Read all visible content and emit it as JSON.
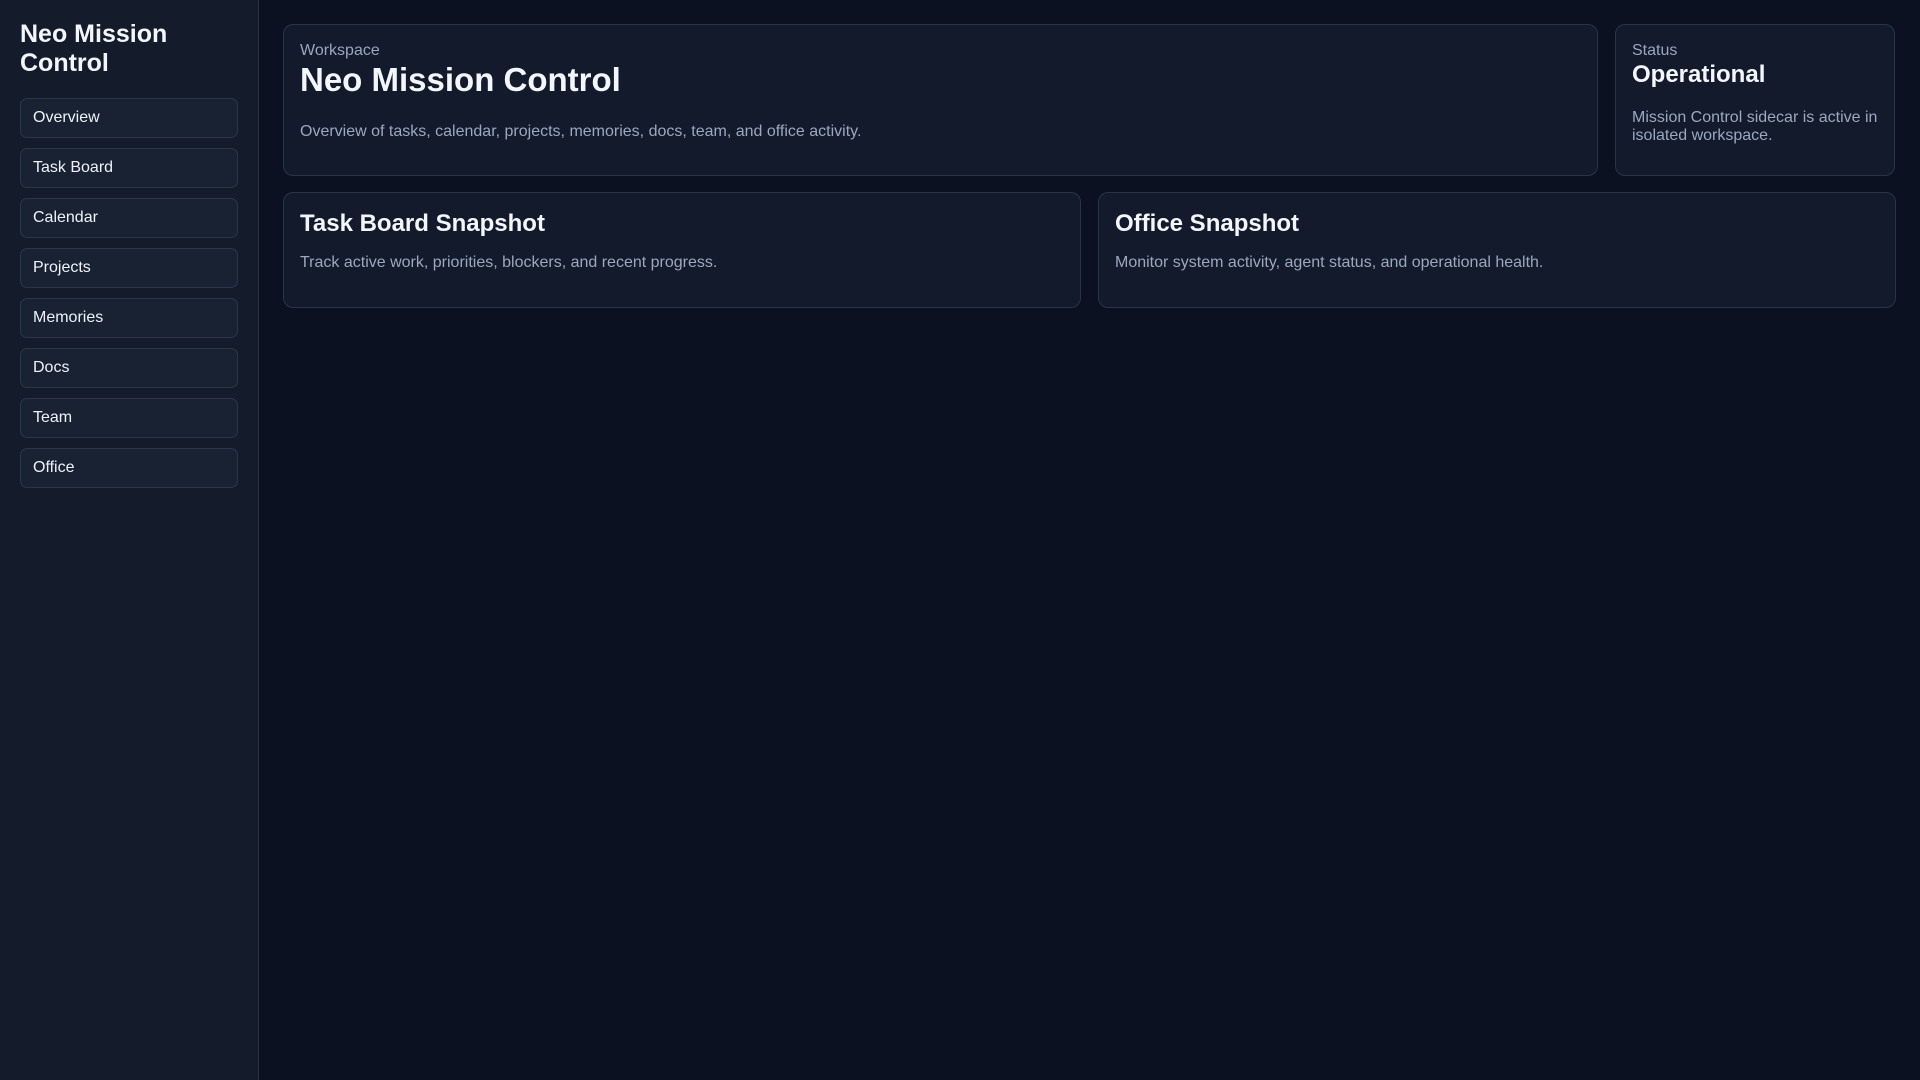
{
  "sidebar": {
    "brand": "Neo Mission Control",
    "items": [
      {
        "label": "Overview"
      },
      {
        "label": "Task Board"
      },
      {
        "label": "Calendar"
      },
      {
        "label": "Projects"
      },
      {
        "label": "Memories"
      },
      {
        "label": "Docs"
      },
      {
        "label": "Team"
      },
      {
        "label": "Office"
      }
    ]
  },
  "hero": {
    "eyebrow": "Workspace",
    "title": "Neo Mission Control",
    "description": "Overview of tasks, calendar, projects, memories, docs, team, and office activity."
  },
  "status": {
    "eyebrow": "Status",
    "title": "Operational",
    "description": "Mission Control sidecar is active in isolated workspace."
  },
  "snapshots": {
    "task_board": {
      "title": "Task Board Snapshot",
      "description": "Track active work, priorities, blockers, and recent progress."
    },
    "office": {
      "title": "Office Snapshot",
      "description": "Monitor system activity, agent status, and operational health."
    }
  },
  "colors": {
    "background": "#0b1120",
    "sidebar": "#141b2b",
    "card": "#131a2b",
    "border": "#2a3447",
    "text_primary": "#f3f6fb",
    "text_muted": "#9aa8c0"
  }
}
